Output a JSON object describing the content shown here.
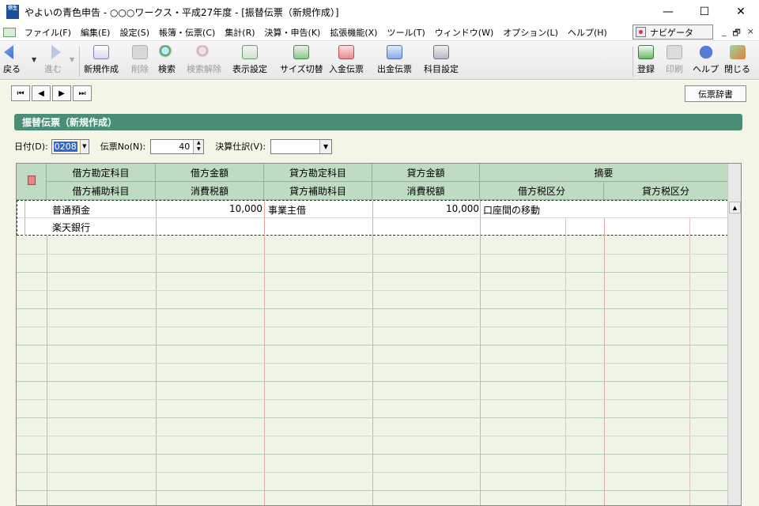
{
  "window": {
    "title": "やよいの青色申告 - ○○○ワークス・平成27年度 - [振替伝票（新規作成）]",
    "icon_label": "弥生",
    "minimize": "—",
    "maximize": "☐",
    "close": "✕"
  },
  "menu": {
    "items": [
      "ファイル(F)",
      "編集(E)",
      "設定(S)",
      "帳簿・伝票(C)",
      "集計(R)",
      "決算・申告(K)",
      "拡張機能(X)",
      "ツール(T)",
      "ウィンドウ(W)",
      "オプション(L)",
      "ヘルプ(H)"
    ],
    "navigator": "ナビゲータ",
    "mdi_min": "_",
    "mdi_restore": "🗗",
    "mdi_close": "×"
  },
  "toolbar": {
    "back": "戻る",
    "forward": "進む",
    "new": "新規作成",
    "delete": "削除",
    "search": "検索",
    "search_clear": "検索解除",
    "display_settings": "表示設定",
    "size_switch": "サイズ切替",
    "deposit_slip": "入金伝票",
    "payment_slip": "出金伝票",
    "account_settings": "科目設定",
    "register": "登録",
    "print": "印刷",
    "help": "ヘルプ",
    "close": "閉じる"
  },
  "colors": {
    "header_band": "#4a8e78",
    "grid_header": "#bfdcc2",
    "grid_bg": "#eef4e6",
    "content_bg": "#f5f5e6"
  },
  "content": {
    "nav_first": "⏮",
    "nav_prev": "◀",
    "nav_next": "▶",
    "nav_last": "⏭",
    "dictionary_button": "伝票辞書",
    "header_title": "振替伝票（新規作成）",
    "date_label": "日付(D):",
    "date_value": "0208",
    "slip_no_label": "伝票No(N):",
    "slip_no_value": "40",
    "kessan_label": "決算仕訳(V):",
    "kessan_value": ""
  },
  "grid": {
    "headers_top": [
      "借方勘定科目",
      "借方金額",
      "貸方勘定科目",
      "貸方金額",
      "摘要"
    ],
    "headers_bottom": [
      "借方補助科目",
      "消費税額",
      "貸方補助科目",
      "消費税額",
      "借方税区分",
      "貸方税区分"
    ],
    "row1": {
      "debit_account": "普通預金",
      "debit_amount": "10,000",
      "credit_account": "事業主借",
      "credit_amount": "10,000",
      "memo": "口座間の移動",
      "debit_sub": "楽天銀行"
    }
  }
}
